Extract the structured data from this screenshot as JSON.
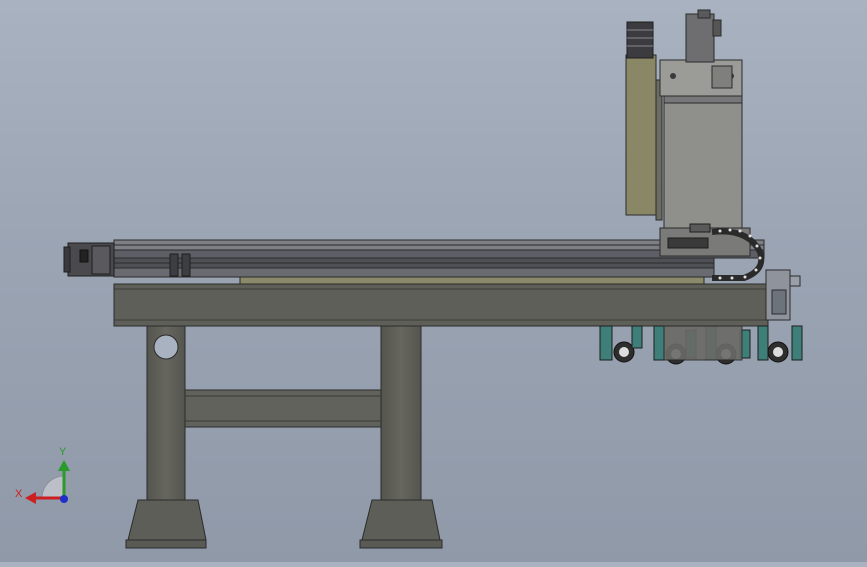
{
  "viewport": {
    "background_top": "#a8b2c0",
    "background_bottom": "#8f99a8"
  },
  "model": {
    "body_color": "#5f5f5a",
    "body_light": "#6b6b65",
    "edge_color": "#2b2b2b",
    "bed_color": "#8a8a6a",
    "olive_panel": "#8a8766",
    "spindle_color": "#8e8e8b",
    "cable_chain": "#3a3a3a",
    "wheel_bracket": "#3f7f7a"
  },
  "triad": {
    "x_label": "X",
    "y_label": "Y",
    "x_color": "#cc1f1f",
    "y_color": "#2a9a2a",
    "z_color": "#1f2fcc"
  }
}
